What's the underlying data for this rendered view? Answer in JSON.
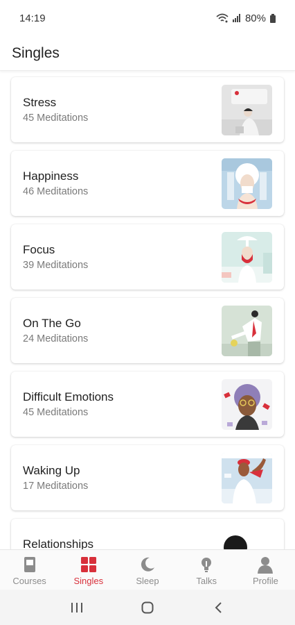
{
  "status": {
    "time": "14:19",
    "battery": "80%"
  },
  "header": {
    "title": "Singles"
  },
  "singles": [
    {
      "title": "Stress",
      "count": "45 Meditations",
      "thumb": "stress-illustration"
    },
    {
      "title": "Happiness",
      "count": "46 Meditations",
      "thumb": "happiness-illustration"
    },
    {
      "title": "Focus",
      "count": "39 Meditations",
      "thumb": "focus-illustration"
    },
    {
      "title": "On The Go",
      "count": "24 Meditations",
      "thumb": "on-the-go-illustration"
    },
    {
      "title": "Difficult Emotions",
      "count": "45 Meditations",
      "thumb": "difficult-emotions-illustration"
    },
    {
      "title": "Waking Up",
      "count": "17 Meditations",
      "thumb": "waking-up-illustration"
    },
    {
      "title": "Relationships",
      "count": "",
      "thumb": "relationships-illustration"
    }
  ],
  "nav": {
    "items": [
      {
        "label": "Courses",
        "icon": "courses-icon",
        "active": false
      },
      {
        "label": "Singles",
        "icon": "singles-grid-icon",
        "active": true
      },
      {
        "label": "Sleep",
        "icon": "moon-icon",
        "active": false
      },
      {
        "label": "Talks",
        "icon": "lightbulb-icon",
        "active": false
      },
      {
        "label": "Profile",
        "icon": "profile-icon",
        "active": false
      }
    ]
  },
  "colors": {
    "accent": "#d8303b",
    "inactive": "#8c8c8c"
  }
}
